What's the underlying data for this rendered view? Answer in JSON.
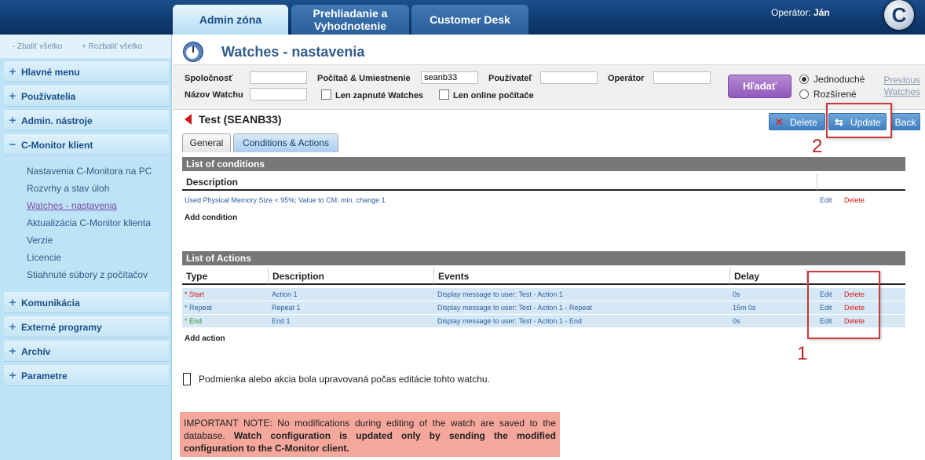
{
  "topbar": {
    "tabs": [
      "Admin zóna",
      "Prehliadanie a Vyhodnotenie",
      "Customer Desk"
    ],
    "operator_label": "Operátor:",
    "operator_name": "Ján",
    "logo_letter": "C"
  },
  "sidebar": {
    "collapse_all": "Zbaliť všetko",
    "expand_all": "Rozbaliť všetko",
    "items": [
      {
        "label": "Hlavné menu",
        "state": "+"
      },
      {
        "label": "Používatelia",
        "state": "+"
      },
      {
        "label": "Admin. nástroje",
        "state": "+"
      },
      {
        "label": "C-Monitor klient",
        "state": "−"
      },
      {
        "label": "Komunikácia",
        "state": "+"
      },
      {
        "label": "Externé programy",
        "state": "+"
      },
      {
        "label": "Archív",
        "state": "+"
      },
      {
        "label": "Parametre",
        "state": "+"
      }
    ],
    "subitems": [
      "Nastavenia C-Monitora na PC",
      "Rozvrhy a stav úloh",
      "Watches - nastavenia",
      "Aktualizácia C-Monitor klienta",
      "Verzie",
      "Licencie",
      "Stiahnuté súbory z počítačov"
    ],
    "active_subitem": "Watches - nastavenia"
  },
  "page": {
    "title": "Watches - nastavenia"
  },
  "search": {
    "company_label": "Spoločnosť",
    "company_value": "",
    "computer_label": "Počítač & Umiestnenie",
    "computer_value": "seanb33",
    "user_label": "Používateľ",
    "user_value": "",
    "operator_label": "Operátor",
    "operator_value": "",
    "watch_name_label": "Názov Watchu",
    "watch_name_value": "",
    "only_enabled_label": "Len zapnuté Watches",
    "only_online_label": "Len online počítače",
    "search_button": "Hľadať",
    "mode_simple": "Jednoduché",
    "mode_extended": "Rozšírené",
    "previous_watches": "Previous Watches"
  },
  "watch": {
    "title": "Test (SEANB33)",
    "delete_label": "Delete",
    "update_label": "Update",
    "back_label": "Back",
    "tabs": [
      "General",
      "Conditions & Actions"
    ],
    "active_tab": "Conditions & Actions"
  },
  "conditions": {
    "section_title": "List of conditions",
    "header_description": "Description",
    "rows": [
      {
        "description": "Used Physical Memory Size < 95%; Value to CM: min. change 1",
        "edit": "Edit",
        "delete": "Delete"
      }
    ],
    "add_label": "Add condition"
  },
  "actions": {
    "section_title": "List of Actions",
    "headers": [
      "Type",
      "Description",
      "Events",
      "Delay"
    ],
    "rows": [
      {
        "type": "* Start",
        "description": "Action 1",
        "events": "Display message to user: Test - Action 1",
        "delay": "0s",
        "edit": "Edit",
        "delete": "Delete",
        "type_color": "#d51b1b"
      },
      {
        "type": "* Repeat",
        "description": "Repeat 1",
        "events": "Display message to user: Test - Action 1 - Repeat",
        "delay": "15m 0s",
        "edit": "Edit",
        "delete": "Delete",
        "type_color": "#2b5e9e"
      },
      {
        "type": "* End",
        "description": "End 1",
        "events": "Display message to user: Test - Action 1 - End",
        "delay": "0s",
        "edit": "Edit",
        "delete": "Delete",
        "type_color": "#2c8e16"
      }
    ],
    "add_label": "Add action"
  },
  "annotations": {
    "label_1": "1",
    "label_2": "2"
  },
  "legend": {
    "text": "Podmienka alebo akcia bola upravovaná počas editácie tohto watchu."
  },
  "note": {
    "normal": "IMPORTANT NOTE: No modifications during editing of the watch are saved to the database.",
    "bold": "Watch configuration is updated only by sending the modified configuration to the C-Monitor client."
  }
}
